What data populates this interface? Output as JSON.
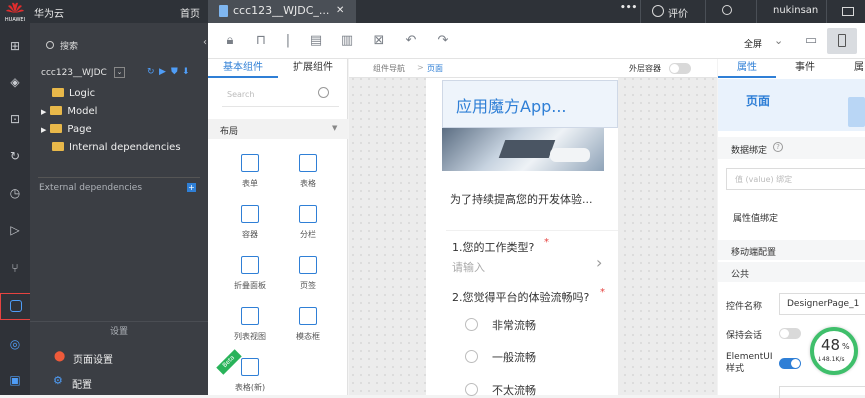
{
  "topbar": {
    "logo_text": "HUAWEI",
    "brand": "华为云",
    "home": "首页",
    "file_tab": "ccc123__WJDC_...",
    "close_glyph": "✕",
    "more_glyph": "•••",
    "rating": "评价",
    "user": "nukinsan"
  },
  "tree": {
    "search_placeholder": "搜索",
    "project": "ccc123__WJDC",
    "items": [
      {
        "label": "Logic"
      },
      {
        "label": "Model"
      },
      {
        "label": "Page"
      },
      {
        "label": "Internal dependencies"
      }
    ],
    "external": "External dependencies",
    "settings_title": "设置",
    "page_settings": "页面设置",
    "config": "配置"
  },
  "toolbar": {
    "fullscreen": "全屏"
  },
  "components": {
    "tabs": [
      "基本组件",
      "扩展组件"
    ],
    "search_placeholder": "Search",
    "section": "布局",
    "items": [
      {
        "label": "表单"
      },
      {
        "label": "表格"
      },
      {
        "label": "容器"
      },
      {
        "label": "分栏"
      },
      {
        "label": "折叠面板"
      },
      {
        "label": "页签"
      },
      {
        "label": "列表视图"
      },
      {
        "label": "模态框"
      },
      {
        "label": "表格(新)"
      }
    ],
    "beta_badge": "Beta"
  },
  "canvas": {
    "breadcrumb_root": "组件导航",
    "breadcrumb_sep": ">",
    "breadcrumb_current": "页面",
    "outer_container": "外层容器",
    "app_title": "应用魔方App...",
    "intro": "为了持续提高您的开发体验...",
    "q1": "1.您的工作类型?",
    "required": "*",
    "q1_placeholder": "请输入",
    "q2": "2.您觉得平台的体验流畅吗?",
    "options": [
      "非常流畅",
      "一般流畅",
      "不太流畅"
    ]
  },
  "properties": {
    "tabs": [
      "属性",
      "事件",
      "属"
    ],
    "page_label": "页面",
    "data_binding": "数据绑定",
    "value_placeholder": "值 (value) 绑定",
    "prop_value_binding": "属性值绑定",
    "mobile_config": "移动端配置",
    "public": "公共",
    "control_name_label": "控件名称",
    "control_name_value": "DesignerPage_1",
    "keep_session": "保持会话",
    "elementui_label": "ElementUI样式",
    "elementui_on": true,
    "keep_session_on": false
  },
  "speed": {
    "percent": "48",
    "percent_sign": "%",
    "rate": "↓48.1K/s"
  },
  "colors": {
    "accent": "#2f7fd6",
    "topbar": "#2e3238",
    "tree_bg": "#3b3e44",
    "active_rail": "#e64340",
    "speed_green": "#3fbf6b"
  }
}
